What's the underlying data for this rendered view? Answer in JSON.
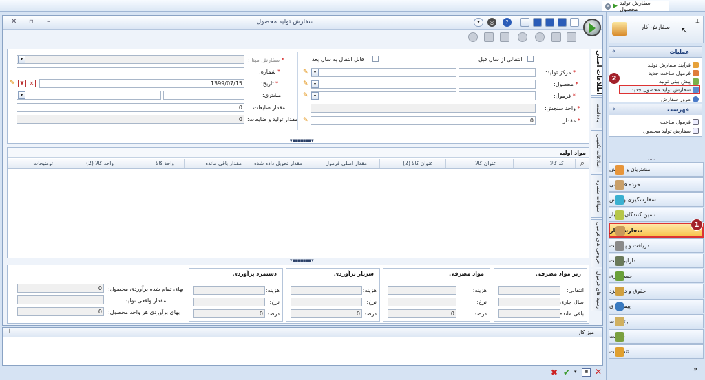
{
  "doc_tab": {
    "title": "سفارش تولید محصول"
  },
  "window": {
    "title": "سفارش تولید محصول"
  },
  "tabs": [
    "اطلاعات اصلی",
    "یادداشت",
    "اطلاعات تکمیلی",
    "سوالات شماره",
    "خروجی های فرمول",
    "رسید های فرمول"
  ],
  "form": {
    "left": {
      "base_order": {
        "label": "سفارش مبنا :",
        "value": ""
      },
      "number": {
        "label": "شماره:",
        "value": ""
      },
      "date": {
        "label": "تاریخ:",
        "value": "1399/07/15"
      },
      "customer": {
        "label": "مشتری:",
        "value": ""
      },
      "waste_qty": {
        "label": "مقدار ضایعات:",
        "value": "0"
      },
      "prod_waste_qty": {
        "label": "مقدار تولید و ضایعات:",
        "value": "0"
      }
    },
    "right": {
      "transfer_prev": {
        "label": "انتقالی از سال قبل"
      },
      "transferable_next": {
        "label": "قابل انتقال به سال بعد"
      },
      "production_center": {
        "label": "مرکز تولید:"
      },
      "product": {
        "label": "محصول:"
      },
      "formula": {
        "label": "فرمول:"
      },
      "unit": {
        "label": "واحد سنجش:"
      },
      "quantity": {
        "label": "مقدار:",
        "value": "0"
      }
    }
  },
  "grid": {
    "title": "مواد اولیه",
    "columns": [
      "کد کالا",
      "عنوان کالا",
      "عنوان کالا (2)",
      "مقدار اصلی فرمول",
      "مقدار تحویل داده شده",
      "مقدار باقی مانده",
      "واحد کالا",
      "واحد کالا (2)",
      "توضیحات"
    ]
  },
  "bottom": {
    "raw_material": {
      "title": "ریز مواد مصرفی",
      "fields": [
        "انتقالی:",
        "سال جاری:",
        "باقی مانده:"
      ]
    },
    "consumed": {
      "title": "مواد مصرفی",
      "fields": [
        "هزینه:",
        "نرخ:",
        "درصد:"
      ],
      "pct": "0"
    },
    "overhead": {
      "title": "سربار برآوردی",
      "fields": [
        "هزینه:",
        "نرخ:",
        "درصد:"
      ],
      "pct": "0"
    },
    "wage": {
      "title": "دستمزد برآوردی",
      "fields": [
        "هزینه:",
        "نرخ:",
        "درصد:"
      ],
      "pct": "0"
    },
    "totals": {
      "total_cost": {
        "label": "بهای تمام شده برآوردی محصول:",
        "value": "0"
      },
      "actual_qty": {
        "label": "مقدار واقعی تولید:",
        "value": ""
      },
      "unit_cost": {
        "label": "بهای برآوردی هر واحد محصول:",
        "value": "0"
      }
    }
  },
  "desk": {
    "title": "میز کار"
  },
  "right_panel": {
    "header": "سفارش کار",
    "operations": {
      "title": "عملیات",
      "items": [
        "فرآیند سفارش تولید",
        "فرمول ساخت جدید",
        "پیش بینی تولید",
        "سفارش تولید محصول جدید",
        "مرور سفارش"
      ]
    },
    "list": {
      "title": "فهرست",
      "items": [
        "فرمول ساخت",
        "سفارش تولید محصول"
      ]
    },
    "modules": [
      "مشتریان و فروش",
      "خرده فروشی",
      "سفارشگیری و پخش",
      "تامین کنندگان و انبار",
      "سفارش کار",
      "دریافت و پرداخت",
      "دارایی ثابت",
      "حسابداری",
      "حقوق و دستمزد",
      "پیمانکاری",
      "ارتباطات",
      "شرکت",
      "تنظیمات"
    ],
    "badges": [
      "1",
      "2"
    ]
  },
  "colors": {
    "accent": "#1f3f7a",
    "highlight": "#f8c24a",
    "badge": "#a3212a"
  }
}
